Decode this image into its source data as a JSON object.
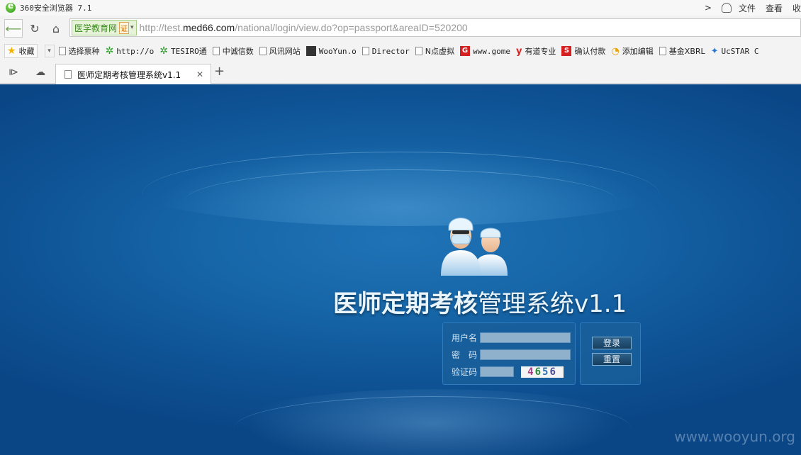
{
  "browser": {
    "title": "360安全浏览器 7.1",
    "menu": {
      "file": "文件",
      "view": "查看",
      "fav": "收"
    },
    "address": {
      "cert_label": "医学教育网",
      "cert_badge": "证",
      "url_prefix": "http://test.",
      "url_domain": "med66.com",
      "url_path": "/national/login/view.do?op=passport&areaID=520200"
    },
    "bookmarks": [
      {
        "label": "收藏",
        "icon": "star-icon"
      },
      {
        "label": "选择票种",
        "icon": "page-icon"
      },
      {
        "label": "http://o",
        "icon": "gear-icon"
      },
      {
        "label": "TESIRO通",
        "icon": "gear-icon"
      },
      {
        "label": "中诚信数",
        "icon": "page-icon"
      },
      {
        "label": "风讯网站",
        "icon": "page-icon"
      },
      {
        "label": "WooYun.o",
        "icon": "wooyun-icon"
      },
      {
        "label": "Director",
        "icon": "page-icon"
      },
      {
        "label": "N点虚拟",
        "icon": "page-icon"
      },
      {
        "label": "www.gome",
        "icon": "gome-icon"
      },
      {
        "label": "有道专业",
        "icon": "youdao-icon"
      },
      {
        "label": "确认付款",
        "icon": "pay-icon"
      },
      {
        "label": "添加编辑",
        "icon": "add-icon"
      },
      {
        "label": "基金XBRL",
        "icon": "page-icon"
      },
      {
        "label": "UcSTAR C",
        "icon": "ucstar-icon"
      }
    ],
    "tab": {
      "label": "医师定期考核管理系统v1.1",
      "close": "✕",
      "new_tab": "+"
    }
  },
  "page": {
    "title_bold": "医师定期考核",
    "title_rest": "管理系统v1.1",
    "form": {
      "username_label": "用户名",
      "password_label": "密　码",
      "captcha_label": "验证码",
      "captcha_digits": [
        "4",
        "6",
        "5",
        "6"
      ]
    },
    "buttons": {
      "login": "登录",
      "reset": "重置"
    },
    "watermark": "www.wooyun.org"
  }
}
